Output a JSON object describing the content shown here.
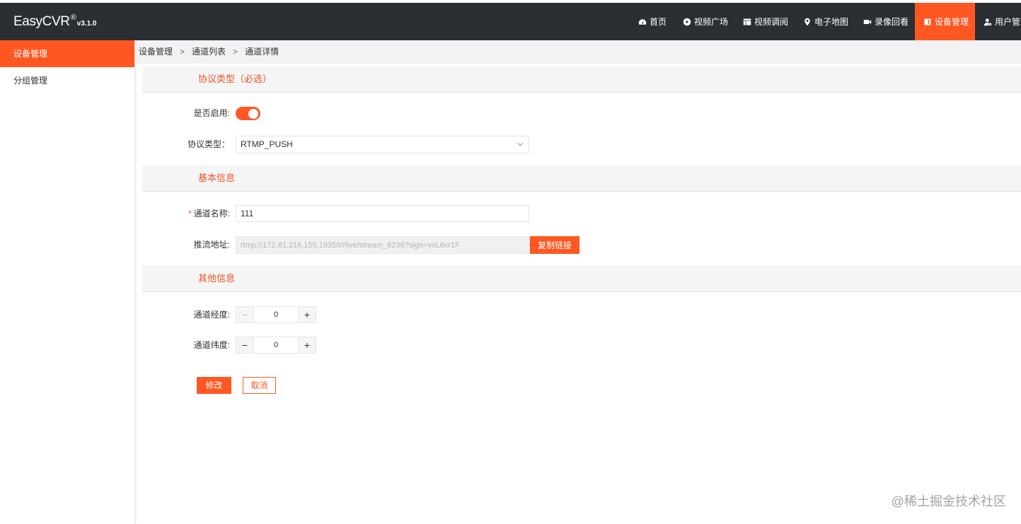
{
  "colors": {
    "accent": "#ff5722",
    "header_bg": "#2b2f33",
    "section_title": "#f0522b"
  },
  "header": {
    "logo": {
      "name": "EasyCVR",
      "mark": "®",
      "version": "v3.1.0"
    },
    "nav": [
      {
        "label": "首页",
        "icon": "dashboard-icon",
        "active": false
      },
      {
        "label": "视频广场",
        "icon": "play-circle-icon",
        "active": false
      },
      {
        "label": "视频调阅",
        "icon": "table-icon",
        "active": false
      },
      {
        "label": "电子地图",
        "icon": "map-marker-icon",
        "active": false
      },
      {
        "label": "录像回看",
        "icon": "video-camera-icon",
        "active": false
      },
      {
        "label": "设备管理",
        "icon": "device-icon",
        "active": true
      },
      {
        "label": "用户管理",
        "icon": "user-icon",
        "active": false
      }
    ]
  },
  "sidebar": {
    "items": [
      {
        "label": "设备管理",
        "active": true
      },
      {
        "label": "分组管理",
        "active": false
      }
    ]
  },
  "breadcrumb": {
    "items": [
      "设备管理",
      "通道列表",
      "通道详情"
    ],
    "separator": ">"
  },
  "form": {
    "protocol_section": {
      "title": "协议类型（必选）",
      "enabled": {
        "label": "是否启用:",
        "value": true
      },
      "protocol_type": {
        "label": "协议类型：",
        "value": "RTMP_PUSH"
      }
    },
    "basic_section": {
      "title": "基本信息",
      "channel_name": {
        "required_mark": "*",
        "label": "通道名称:",
        "value": "111"
      },
      "push_url": {
        "label": "推流地址:",
        "value": "rtmp://172.81.216.155:19350/rlive/stream_8236?sign=vxL6xr1F",
        "copy_button": "复制链接"
      }
    },
    "other_section": {
      "title": "其他信息",
      "longitude": {
        "label": "通道经度:",
        "value": "0",
        "minus": "−",
        "plus": "+"
      },
      "latitude": {
        "label": "通道纬度:",
        "value": "0",
        "minus": "−",
        "plus": "+"
      }
    },
    "actions": {
      "submit": "修改",
      "cancel": "取消"
    }
  },
  "watermark": "@稀土掘金技术社区"
}
